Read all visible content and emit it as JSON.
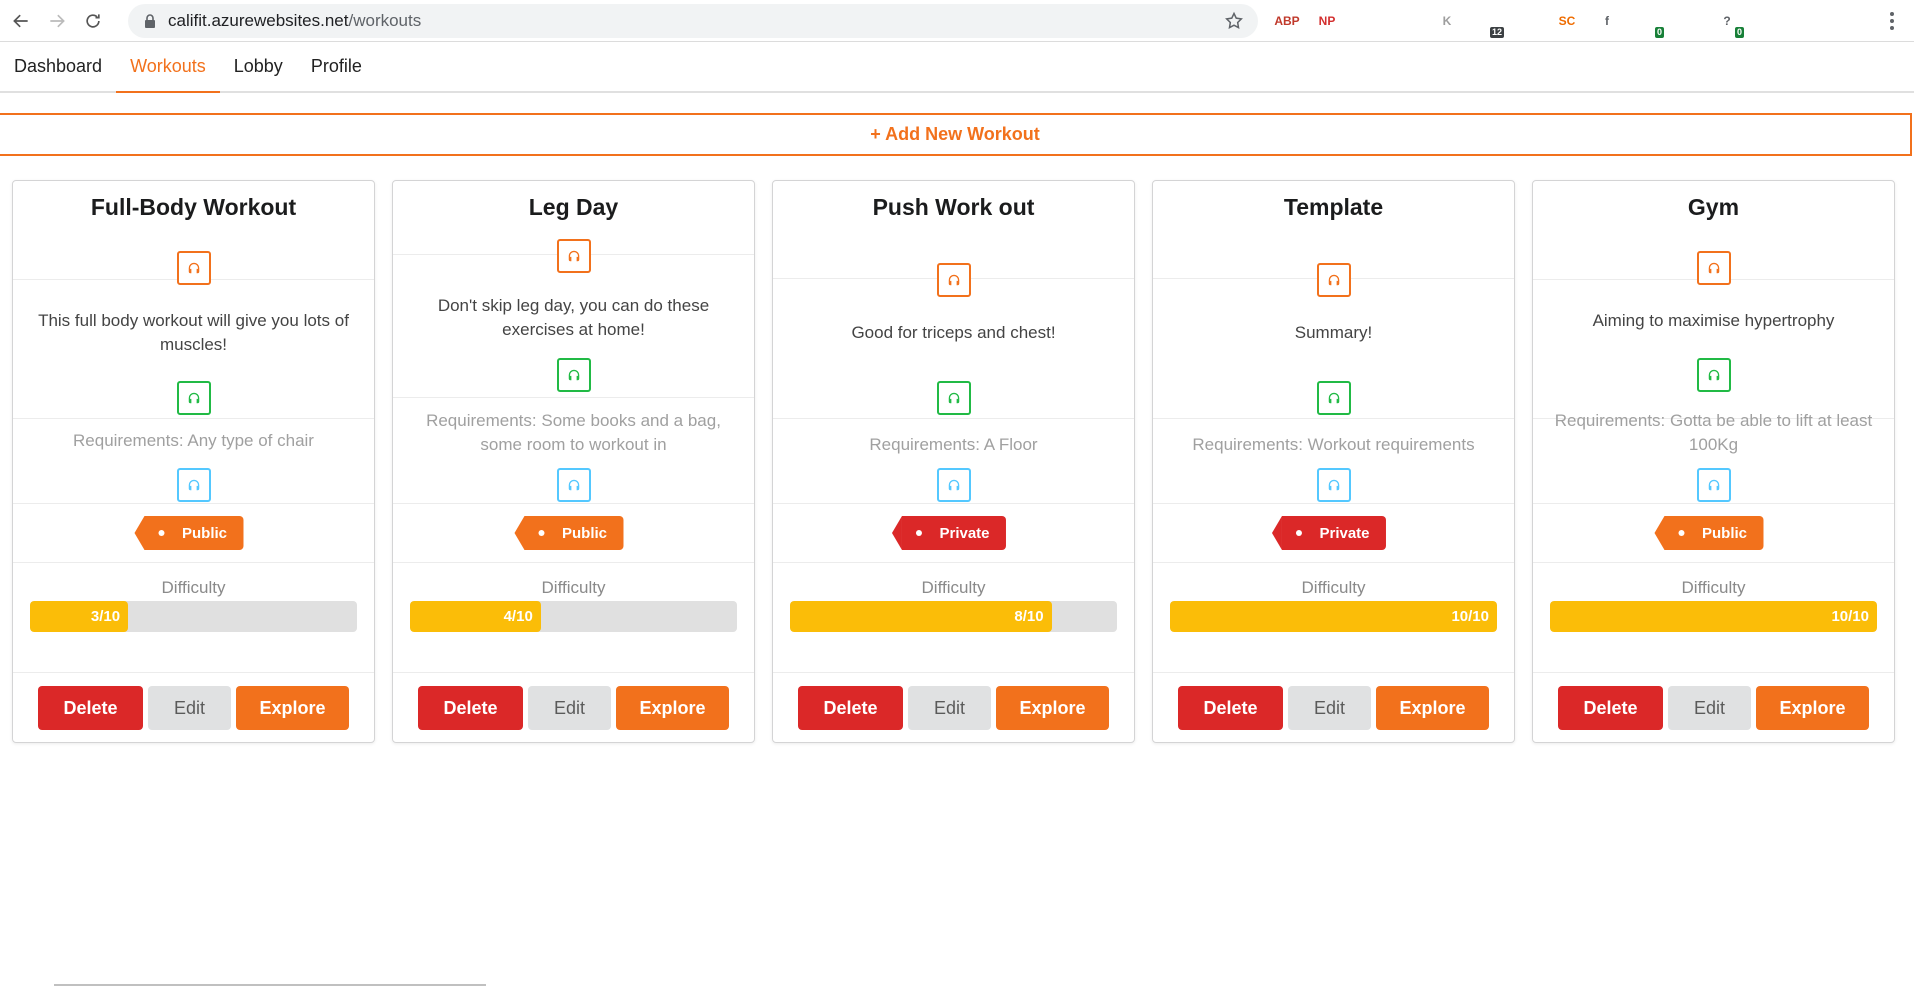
{
  "browser": {
    "url_host": "califit.azurewebsites.net",
    "url_path": "/workouts",
    "extensions": [
      {
        "name": "abp-icon",
        "text": "ABP",
        "color": "#c0392b",
        "badge": ""
      },
      {
        "name": "np-icon",
        "text": "NP",
        "color": "#d32f2f",
        "badge": ""
      },
      {
        "name": "refresh-ext-icon",
        "text": "",
        "color": "#9e9e9e",
        "badge": ""
      },
      {
        "name": "react-devtools-icon",
        "text": "",
        "color": "#61dafb",
        "badge": ""
      },
      {
        "name": "k-ext-icon",
        "text": "K",
        "color": "#9e9e9e",
        "badge": ""
      },
      {
        "name": "shield-ext-icon",
        "text": "",
        "color": "#607d8b",
        "badge": "12"
      },
      {
        "name": "check-ext-icon",
        "text": "",
        "color": "#188038",
        "badge": ""
      },
      {
        "name": "sc-ext-icon",
        "text": "SC",
        "color": "#ef6c00",
        "badge": ""
      },
      {
        "name": "facebook-ext-icon",
        "text": "f",
        "color": "#5f6368",
        "badge": ""
      },
      {
        "name": "tracker-ext-icon",
        "text": "",
        "color": "#5f6368",
        "badge": "0"
      },
      {
        "name": "terrarium-ext-icon",
        "text": "",
        "color": "#8d6e1c",
        "badge": ""
      },
      {
        "name": "help-ext-icon",
        "text": "?",
        "color": "#5f6368",
        "badge": "0"
      },
      {
        "name": "puzzle-icon",
        "text": "",
        "color": "#5f6368",
        "badge": ""
      },
      {
        "name": "playlist-icon",
        "text": "",
        "color": "#5f6368",
        "badge": ""
      },
      {
        "name": "profile-avatar",
        "text": "",
        "color": "#5f6368",
        "badge": ""
      }
    ]
  },
  "tabs": [
    {
      "label": "Dashboard",
      "active": false
    },
    {
      "label": "Workouts",
      "active": true
    },
    {
      "label": "Lobby",
      "active": false
    },
    {
      "label": "Profile",
      "active": false
    }
  ],
  "add_button": "+ Add New Workout",
  "labels": {
    "difficulty": "Difficulty",
    "delete": "Delete",
    "edit": "Edit",
    "explore": "Explore"
  },
  "workouts": [
    {
      "title": "Full-Body Workout",
      "description": "This full body workout will give you lots of muscles!",
      "requirements": "Requirements: Any type of chair",
      "visibility": "Public",
      "difficulty": 3,
      "difficulty_text": "3/10"
    },
    {
      "title": "Leg Day",
      "description": "Don't skip leg day, you can do these exercises at home!",
      "requirements": "Requirements: Some books and a bag, some room to workout in",
      "visibility": "Public",
      "difficulty": 4,
      "difficulty_text": "4/10"
    },
    {
      "title": "Push Work out",
      "description": "Good for triceps and chest!",
      "requirements": "Requirements: A Floor",
      "visibility": "Private",
      "difficulty": 8,
      "difficulty_text": "8/10"
    },
    {
      "title": "Template",
      "description": "Summary!",
      "requirements": "Requirements: Workout requirements",
      "visibility": "Private",
      "difficulty": 10,
      "difficulty_text": "10/10"
    },
    {
      "title": "Gym",
      "description": "Aiming to maximise hypertrophy",
      "requirements": "Requirements: Gotta be able to lift at least 100Kg",
      "visibility": "Public",
      "difficulty": 10,
      "difficulty_text": "10/10"
    }
  ],
  "colors": {
    "accent": "#f2711c",
    "danger": "#db2828",
    "difficulty_fill": "#fbbd08"
  }
}
